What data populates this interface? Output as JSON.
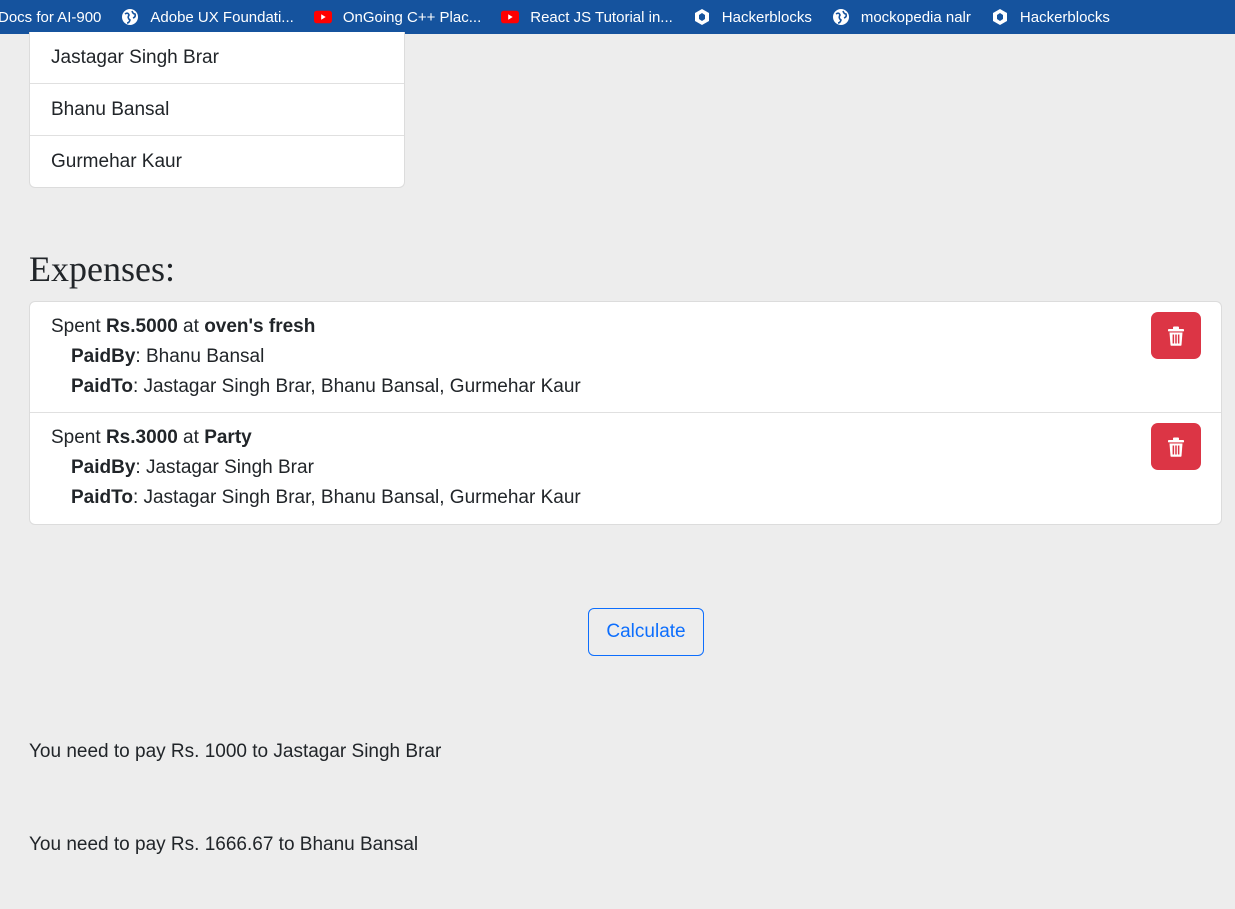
{
  "bookmarks": [
    {
      "label": "Docs for AI-900",
      "icon": "none"
    },
    {
      "label": "Adobe UX Foundati...",
      "icon": "globe-icon"
    },
    {
      "label": "OnGoing C++ Plac...",
      "icon": "youtube-icon"
    },
    {
      "label": "React JS Tutorial in...",
      "icon": "youtube-icon"
    },
    {
      "label": "Hackerblocks",
      "icon": "hackerblocks-icon"
    },
    {
      "label": "mockopedia nalr",
      "icon": "globe-icon"
    },
    {
      "label": "Hackerblocks",
      "icon": "hackerblocks-icon"
    }
  ],
  "members": [
    "Jastagar Singh Brar",
    "Bhanu Bansal",
    "Gurmehar Kaur"
  ],
  "expenses_heading": "Expenses:",
  "expenses": [
    {
      "spent_prefix": "Spent ",
      "amount": "Rs.5000",
      "at_text": " at ",
      "place": "oven's fresh",
      "paid_by_label": "PaidBy",
      "paid_by": ": Bhanu Bansal",
      "paid_to_label": "PaidTo",
      "paid_to": ": Jastagar Singh Brar, Bhanu Bansal, Gurmehar Kaur"
    },
    {
      "spent_prefix": "Spent ",
      "amount": "Rs.3000",
      "at_text": " at ",
      "place": "Party",
      "paid_by_label": "PaidBy",
      "paid_by": ": Jastagar Singh Brar",
      "paid_to_label": "PaidTo",
      "paid_to": ": Jastagar Singh Brar, Bhanu Bansal, Gurmehar Kaur"
    }
  ],
  "calculate_label": "Calculate",
  "results": [
    "You need to pay Rs. 1000 to Jastagar Singh Brar",
    "You need to pay Rs. 1666.67 to Bhanu Bansal"
  ],
  "colors": {
    "bookmarks_bar": "#15539e",
    "delete_button": "#dc3545",
    "primary": "#0d6efd",
    "background": "#ededed"
  }
}
